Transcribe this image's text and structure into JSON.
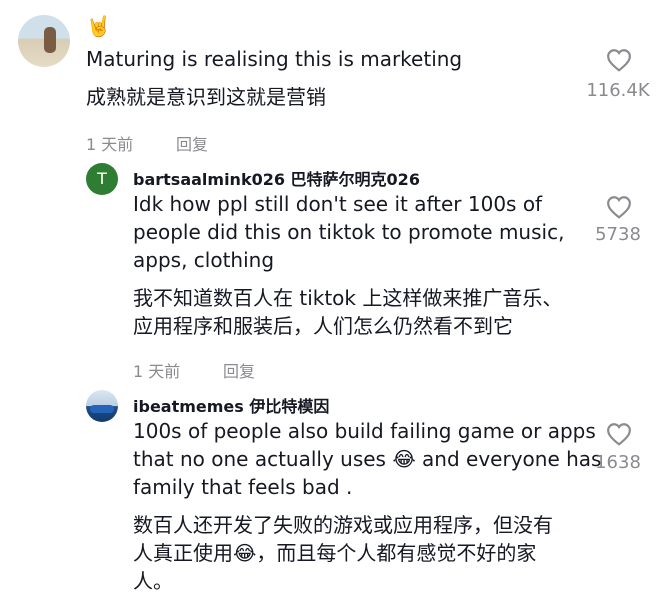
{
  "comments": [
    {
      "handle": "",
      "emoji": "🤘",
      "text_en": "Maturing is realising this is marketing",
      "text_zh": "成熟就是意识到这就是营销",
      "time": "1 天前",
      "reply_label": "回复",
      "likes": "116.4K",
      "avatar_letter": ""
    },
    {
      "handle": "bartsaalmink026 巴特萨尔明克026",
      "text_en_lines": [
        "Idk how ppl still don't see it after 100s of",
        "people did this on tiktok to promote music,",
        "apps, clothing"
      ],
      "text_zh_lines": [
        "我不知道数百人在 tiktok 上这样做来推广音乐、",
        "应用程序和服装后，人们怎么仍然看不到它"
      ],
      "time": "1 天前",
      "reply_label": "回复",
      "likes": "5738",
      "avatar_letter": "T",
      "avatar_color": "#2e7d32"
    },
    {
      "handle": "ibeatmemes 伊比特模因",
      "text_en_lines": [
        "100s of people also build failing game or apps",
        "that no one actually uses 😂 and everyone has",
        "family that feels bad ."
      ],
      "text_zh_lines": [
        "数百人还开发了失败的游戏或应用程序，但没有",
        "人真正使用😂，而且每个人都有感觉不好的家",
        "人。"
      ],
      "likes": "1638"
    }
  ]
}
